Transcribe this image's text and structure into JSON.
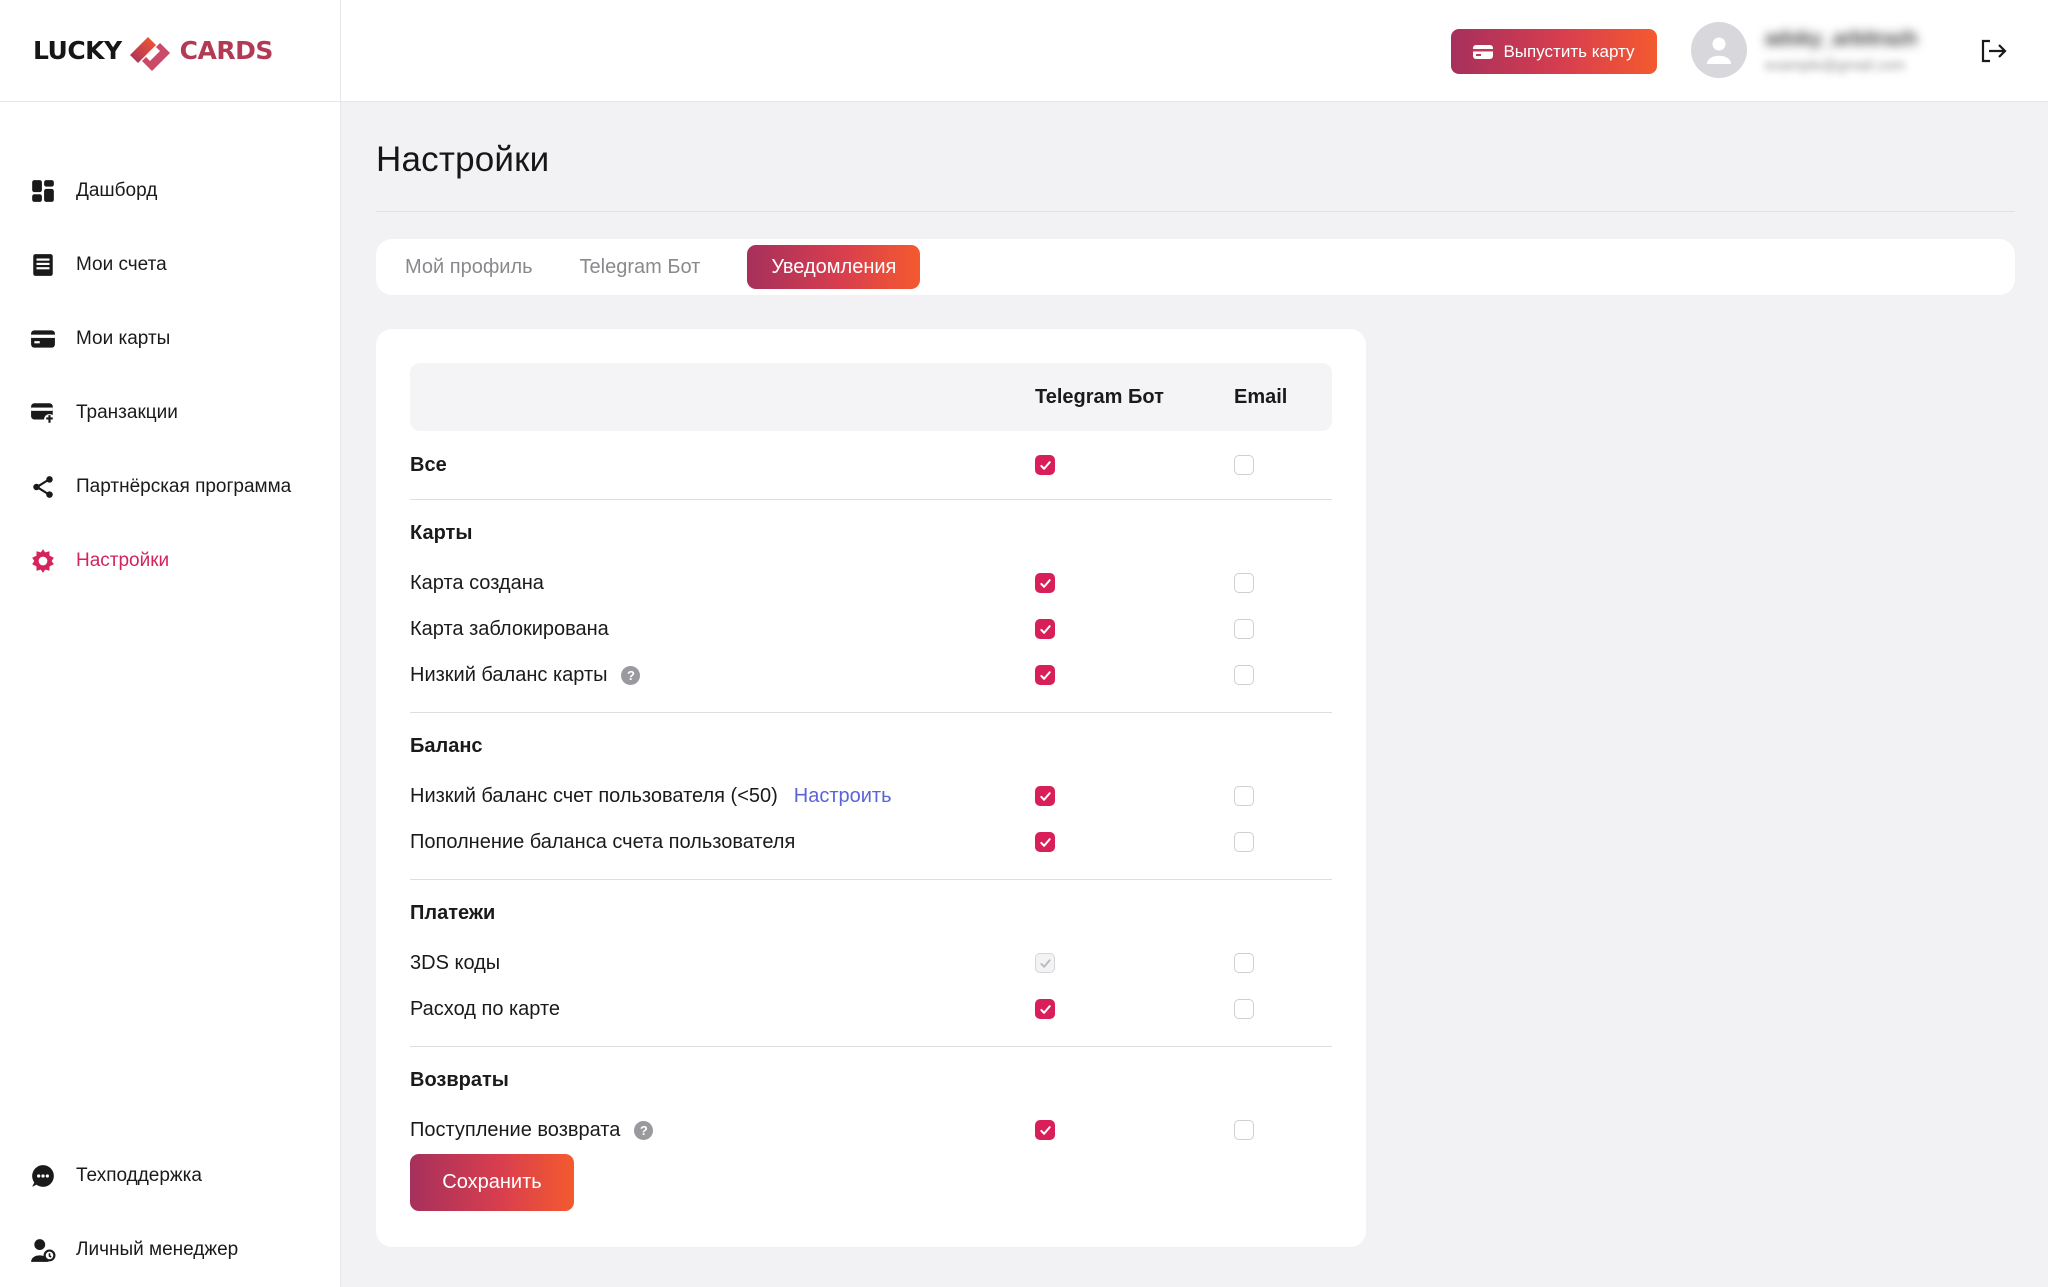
{
  "brand": {
    "left": "LUCKY",
    "right": "CARDS"
  },
  "sidebar": {
    "items": [
      {
        "label": "Дашборд",
        "icon": "dashboard-icon"
      },
      {
        "label": "Мои счета",
        "icon": "accounts-icon"
      },
      {
        "label": "Мои карты",
        "icon": "card-icon"
      },
      {
        "label": "Транзакции",
        "icon": "transactions-icon"
      },
      {
        "label": "Партнёрская программа",
        "icon": "share-icon"
      },
      {
        "label": "Настройки",
        "icon": "settings-icon",
        "active": true
      }
    ],
    "bottom": [
      {
        "label": "Техподдержка",
        "icon": "chat-icon"
      },
      {
        "label": "Личный менеджер",
        "icon": "manager-icon"
      }
    ]
  },
  "header": {
    "issue_button": "Выпустить карту",
    "user_name": "adsky_arbitrazh",
    "user_email": "example@gmail.com"
  },
  "page": {
    "title": "Настройки"
  },
  "tabs": [
    {
      "label": "Мой профиль",
      "active": false
    },
    {
      "label": "Telegram Бот",
      "active": false
    },
    {
      "label": "Уведомления",
      "active": true
    }
  ],
  "table": {
    "columns": {
      "telegram": "Telegram Бот",
      "email": "Email"
    },
    "all": {
      "label": "Все",
      "telegram": "checked",
      "email": "unchecked"
    },
    "sections": [
      {
        "title": "Карты",
        "rows": [
          {
            "label": "Карта создана",
            "telegram": "checked",
            "email": "unchecked"
          },
          {
            "label": "Карта заблокирована",
            "telegram": "checked",
            "email": "unchecked"
          },
          {
            "label": "Низкий баланс карты",
            "telegram": "checked",
            "email": "unchecked",
            "help": true
          }
        ]
      },
      {
        "title": "Баланс",
        "rows": [
          {
            "label": "Низкий баланс счет пользователя (<50)",
            "link": "Настроить",
            "telegram": "checked",
            "email": "unchecked"
          },
          {
            "label": "Пополнение баланса счета пользователя",
            "telegram": "checked",
            "email": "unchecked"
          }
        ]
      },
      {
        "title": "Платежи",
        "rows": [
          {
            "label": "3DS коды",
            "telegram": "disabled",
            "email": "unchecked"
          },
          {
            "label": "Расход по карте",
            "telegram": "checked",
            "email": "unchecked"
          }
        ]
      },
      {
        "title": "Возвраты",
        "rows": [
          {
            "label": "Поступление возврата",
            "telegram": "checked",
            "email": "unchecked",
            "help": true
          }
        ]
      }
    ]
  },
  "save_button": "Сохранить",
  "colors": {
    "accent": "#d81f5a",
    "gradient_start": "#a6305c",
    "gradient_end": "#f45a2e",
    "link": "#5a63d9"
  }
}
